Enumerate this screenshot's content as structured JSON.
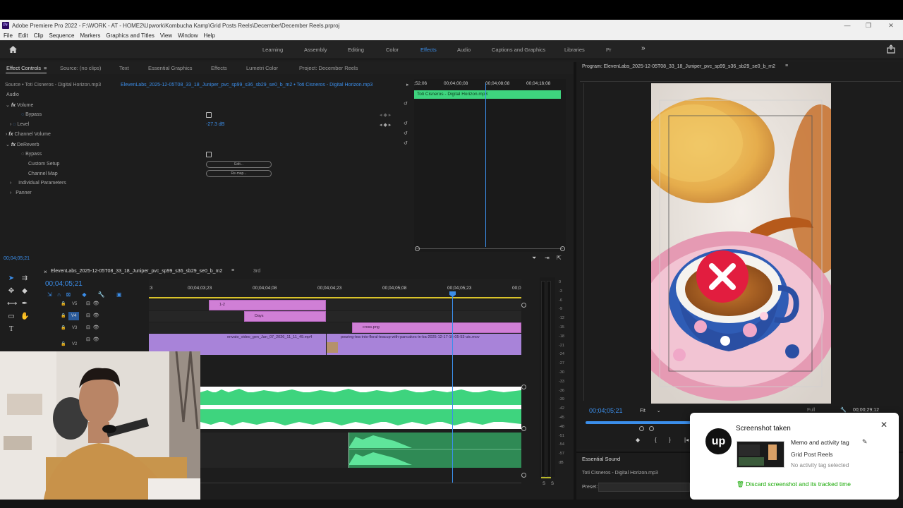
{
  "window": {
    "title": "Adobe Premiere Pro 2022 - F:\\WORK - AT - HOME2\\Upwork\\Kombucha Kamp\\Grid Posts Reels\\December\\December Reels.prproj",
    "app_icon": "Pr"
  },
  "menu": [
    "File",
    "Edit",
    "Clip",
    "Sequence",
    "Markers",
    "Graphics and Titles",
    "View",
    "Window",
    "Help"
  ],
  "workspaces": [
    "Learning",
    "Assembly",
    "Editing",
    "Color",
    "Effects",
    "Audio",
    "Captions and Graphics",
    "Libraries",
    "Pr"
  ],
  "active_workspace": "Effects",
  "left_tabs": [
    "Effect Controls",
    "Source: (no clips)",
    "Text",
    "Essential Graphics",
    "Effects",
    "Lumetri Color",
    "Project: December Reels"
  ],
  "effect_controls": {
    "source": "Source • Toti Cisneros - Digital Horizon.mp3",
    "sequence_clip": "ElevenLabs_2025-12-05T08_33_18_Juniper_pvc_sp99_s36_sb29_se0_b_m2 • Toti Cisneros - Digital Horizon.mp3",
    "section": "Audio",
    "rows": {
      "volume": "Volume",
      "bypass": "Bypass",
      "level": "Level",
      "level_value": "-27.3 dB",
      "channel_volume": "Channel Volume",
      "dereverb": "DeReverb",
      "bypass2": "Bypass",
      "custom_setup": "Custom Setup",
      "custom_setup_btn": "Edit...",
      "channel_map": "Channel Map",
      "channel_map_btn": "Re-map...",
      "individual_params": "Individual Parameters",
      "panner": "Panner"
    },
    "fx_label": "fx",
    "timecode": "00;04;05;21",
    "mini_ruler": [
      ";52;06",
      "00;04;00;08",
      "00;04;08;08",
      "00;04;16;08"
    ],
    "mini_clip": "Toti Cisneros - Digital Horizon.mp3"
  },
  "timeline": {
    "sequence_tab": "ElevenLabs_2025-12-05T08_33_18_Juniper_pvc_sp99_s36_sb29_se0_b_m2",
    "second_tab": "3rd",
    "timecode": "00;04;05;21",
    "ruler": [
      "00;04;03;23",
      "00;04;04;08",
      "00;04;04;23",
      "00;04;05;08",
      "00;04;05;23",
      "00;0"
    ],
    "ruler_start": ":3",
    "tracks": [
      "V5",
      "V4",
      "V3",
      "V2"
    ],
    "clips": {
      "c12": "1-2",
      "days": "Days",
      "cross": "cross.png",
      "envato": "envato_video_gen_Jan_07_2026_11_11_49.mp4",
      "pouring": "pouring-tea-into-floral-teacup-with-pancakes-in-ba-2025-12-17-16-05-53-utc.mov"
    }
  },
  "meter": {
    "labels": [
      "0",
      "-3",
      "-6",
      "-9",
      "-12",
      "-15",
      "-18",
      "-21",
      "-24",
      "-27",
      "-30",
      "-33",
      "-36",
      "-39",
      "-42",
      "-45",
      "-48",
      "-51",
      "-54",
      "-57",
      "dB"
    ],
    "solo": [
      "S",
      "S"
    ]
  },
  "program": {
    "title": "Program: ElevenLabs_2025-12-05T08_33_18_Juniper_pvc_sp99_s36_sb29_se0_b_m2",
    "timecode": "00;04;05;21",
    "fit": "Fit",
    "quality": "Full",
    "duration": "00;00;29;12"
  },
  "essential_sound": {
    "title": "Essential Sound",
    "clip": "Toti Cisneros - Digital Horizon.mp3",
    "preset_label": "Preset:"
  },
  "popup": {
    "title": "Screenshot taken",
    "memo": "Memo and activity tag",
    "project": "Grid Post Reels",
    "activity": "No activity tag selected",
    "discard": "Discard screenshot and its tracked time",
    "brand": "up"
  },
  "colors": {
    "accent_blue": "#3b8eea",
    "audio_green": "#3ed47e",
    "clip_pink": "#d07fd6",
    "clip_purple": "#a883d9",
    "upwork_green": "#14a800"
  }
}
